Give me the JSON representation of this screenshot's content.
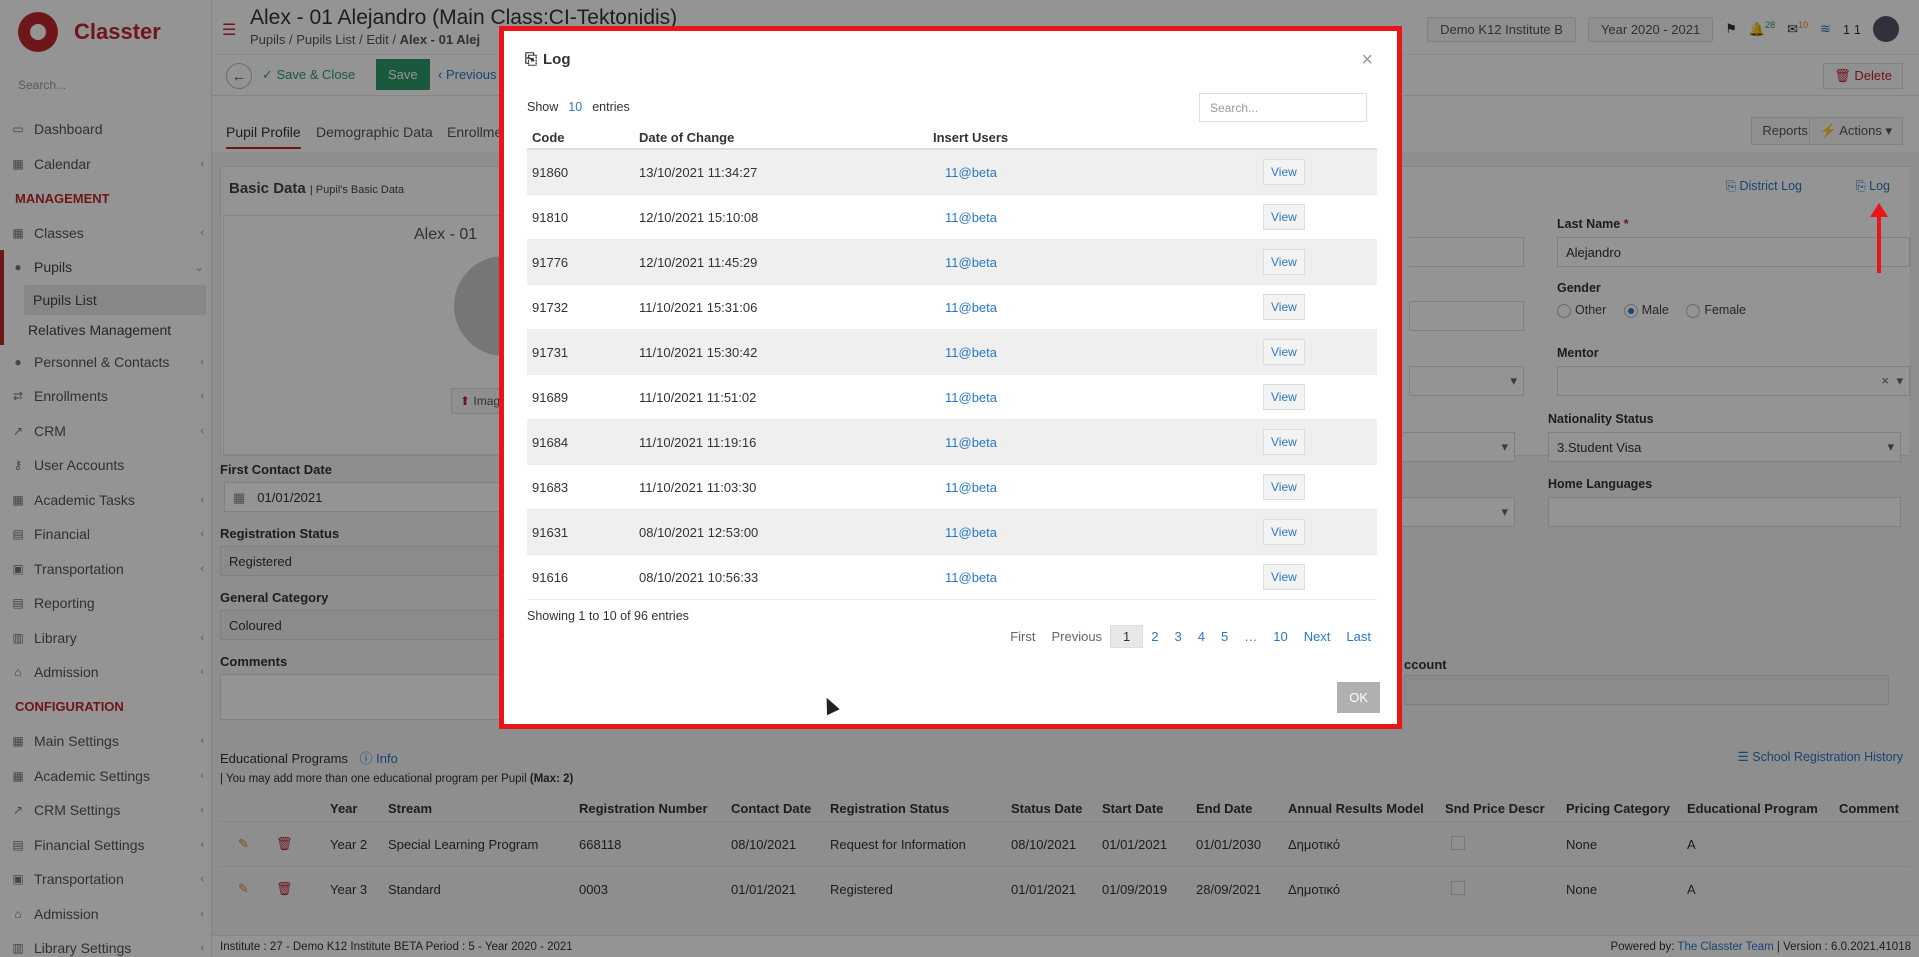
{
  "app": {
    "name": "Classter"
  },
  "sidebar": {
    "search_placeholder": "Search...",
    "items": [
      {
        "label": "Dashboard"
      },
      {
        "label": "Calendar"
      },
      {
        "section": "MANAGEMENT"
      },
      {
        "label": "Classes"
      },
      {
        "label": "Pupils"
      },
      {
        "label": "Pupils List"
      },
      {
        "label": "Relatives Management"
      },
      {
        "label": "Personnel & Contacts"
      },
      {
        "label": "Enrollments"
      },
      {
        "label": "CRM"
      },
      {
        "label": "User Accounts"
      },
      {
        "label": "Academic Tasks"
      },
      {
        "label": "Financial"
      },
      {
        "label": "Transportation"
      },
      {
        "label": "Reporting"
      },
      {
        "label": "Library"
      },
      {
        "label": "Admission"
      },
      {
        "section": "CONFIGURATION"
      },
      {
        "label": "Main Settings"
      },
      {
        "label": "Academic Settings"
      },
      {
        "label": "CRM Settings"
      },
      {
        "label": "Financial Settings"
      },
      {
        "label": "Transportation"
      },
      {
        "label": "Admission"
      },
      {
        "label": "Library Settings"
      }
    ]
  },
  "header": {
    "title": "Alex - 01 Alejandro (Main Class:CI-Tektonidis)",
    "breadcrumb": [
      "Pupils",
      "Pupils List",
      "Edit",
      "Alex - 01 Alej"
    ],
    "institute": "Demo K12 Institute B",
    "year": "Year 2020 - 2021",
    "badge_notifications": "28",
    "badge_messages": "10",
    "user_short": "1 1"
  },
  "toolbar": {
    "save_close": "Save & Close",
    "save": "Save",
    "previous": "Previous",
    "delete": "Delete"
  },
  "tabs": [
    "Pupil Profile",
    "Demographic Data",
    "Enrollme"
  ],
  "actions": {
    "reports": "Reports",
    "actions": "Actions"
  },
  "basic": {
    "title": "Basic Data",
    "subtitle": "| Pupil's Basic Data",
    "name_partial": "Alex - 01",
    "image_btn": "Imag",
    "district_log": "District Log",
    "log": "Log",
    "first_contact_label": "First Contact Date",
    "first_contact_value": "01/01/2021",
    "reg_status_label": "Registration Status",
    "reg_status_value": "Registered",
    "gen_cat_label": "General Category",
    "gen_cat_value": "Coloured",
    "comments_label": "Comments",
    "last_name_label": "Last Name",
    "last_name_value": "Alejandro",
    "gender_label": "Gender",
    "gender_other": "Other",
    "gender_male": "Male",
    "gender_female": "Female",
    "mentor_label": "Mentor",
    "nationality_label": "Nationality Status",
    "nationality_value": "3.Student Visa",
    "home_lang_label": "Home Languages",
    "account_partial": "ccount"
  },
  "edu": {
    "title": "Educational Programs",
    "info": "Info",
    "note": "| You may add more than one educational program per Pupil",
    "note_max": "(Max: 2)",
    "history": "School Registration History",
    "columns": [
      "Year",
      "Stream",
      "Registration Number",
      "Contact Date",
      "Registration Status",
      "Status Date",
      "Start Date",
      "End Date",
      "Annual Results Model",
      "Snd Price Descr",
      "Pricing Category",
      "Educational Program",
      "Comment"
    ],
    "rows": [
      [
        "Year 2",
        "Special Learning Program",
        "668118",
        "08/10/2021",
        "Request for Information",
        "08/10/2021",
        "01/01/2021",
        "01/01/2030",
        "Δημοτικό",
        "",
        "None",
        "A",
        ""
      ],
      [
        "Year 3",
        "Standard",
        "0003",
        "01/01/2021",
        "Registered",
        "01/01/2021",
        "01/09/2019",
        "28/09/2021",
        "Δημοτικό",
        "",
        "None",
        "A",
        ""
      ]
    ]
  },
  "footer": {
    "left": "Institute : 27 - Demo K12 Institute BETA Period : 5 - Year 2020 - 2021",
    "powered": "Powered by:",
    "team": "The Classter Team",
    "version": "| Version : 6.0.2021.41018"
  },
  "modal": {
    "title": "Log",
    "show": "Show",
    "show_count": "10",
    "entries": "entries",
    "search_placeholder": "Search...",
    "columns": [
      "Code",
      "Date of Change",
      "Insert Users"
    ],
    "rows": [
      {
        "code": "91860",
        "date": "13/10/2021 11:34:27",
        "user": "11@beta",
        "action": "View"
      },
      {
        "code": "91810",
        "date": "12/10/2021 15:10:08",
        "user": "11@beta",
        "action": "View"
      },
      {
        "code": "91776",
        "date": "12/10/2021 11:45:29",
        "user": "11@beta",
        "action": "View"
      },
      {
        "code": "91732",
        "date": "11/10/2021 15:31:06",
        "user": "11@beta",
        "action": "View"
      },
      {
        "code": "91731",
        "date": "11/10/2021 15:30:42",
        "user": "11@beta",
        "action": "View"
      },
      {
        "code": "91689",
        "date": "11/10/2021 11:51:02",
        "user": "11@beta",
        "action": "View"
      },
      {
        "code": "91684",
        "date": "11/10/2021 11:19:16",
        "user": "11@beta",
        "action": "View"
      },
      {
        "code": "91683",
        "date": "11/10/2021 11:03:30",
        "user": "11@beta",
        "action": "View"
      },
      {
        "code": "91631",
        "date": "08/10/2021 12:53:00",
        "user": "11@beta",
        "action": "View"
      },
      {
        "code": "91616",
        "date": "08/10/2021 10:56:33",
        "user": "11@beta",
        "action": "View"
      }
    ],
    "info": "Showing 1 to 10 of 96 entries",
    "pagination": [
      "First",
      "Previous",
      "1",
      "2",
      "3",
      "4",
      "5",
      "…",
      "10",
      "Next",
      "Last"
    ],
    "ok": "OK"
  },
  "colors": {
    "brand": "#c0272d",
    "link": "#2a78c4",
    "save": "#2d9a6a",
    "highlight": "#e8151b"
  }
}
